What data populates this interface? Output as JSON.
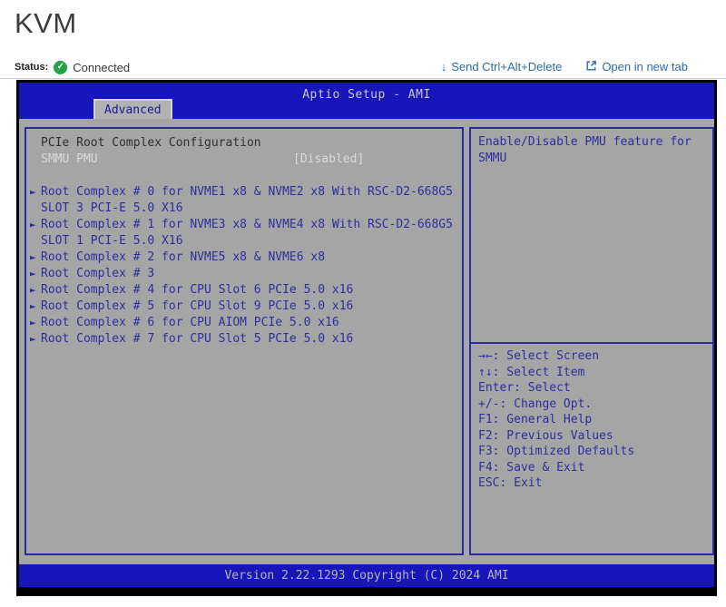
{
  "page": {
    "title": "KVM"
  },
  "status_bar": {
    "label": "Status:",
    "value": "Connected",
    "check_glyph": "✓",
    "links": [
      {
        "label": "Send Ctrl+Alt+Delete",
        "icon_glyph": "↓"
      },
      {
        "label": "Open in new tab"
      }
    ]
  },
  "bios": {
    "header": {
      "title": "Aptio Setup - AMI",
      "tab": "Advanced"
    },
    "icons": {
      "submenu_arrow": "►"
    },
    "left_panel": {
      "section_title": "PCIe Root Complex Configuration",
      "selected_option": {
        "label": "SMMU PMU",
        "value": "[Disabled]"
      },
      "rows": [
        {
          "marker": true,
          "text": "Root Complex # 0 for NVME1 x8 & NVME2 x8 With RSC-D2-668G5"
        },
        {
          "marker": false,
          "text": "SLOT 3 PCI-E 5.0 X16"
        },
        {
          "marker": true,
          "text": "Root Complex # 1 for NVME3 x8 & NVME4 x8 With RSC-D2-668G5"
        },
        {
          "marker": false,
          "text": "SLOT 1 PCI-E 5.0 X16"
        },
        {
          "marker": true,
          "text": "Root Complex # 2 for NVME5 x8 & NVME6 x8"
        },
        {
          "marker": true,
          "text": "Root Complex # 3"
        },
        {
          "marker": true,
          "text": "Root Complex # 4 for CPU Slot 6 PCIe 5.0 x16"
        },
        {
          "marker": true,
          "text": "Root Complex # 5 for CPU Slot 9 PCIe 5.0 x16"
        },
        {
          "marker": true,
          "text": "Root Complex # 6 for CPU AIOM PCIe 5.0 x16"
        },
        {
          "marker": true,
          "text": "Root Complex # 7 for CPU Slot 5 PCIe 5.0 x16"
        }
      ]
    },
    "right_panel": {
      "description": "Enable/Disable PMU feature for SMMU",
      "help_keys": [
        "→←: Select Screen",
        "↑↓: Select Item",
        "Enter: Select",
        "+/-: Change Opt.",
        "F1: General Help",
        "F2: Previous Values",
        "F3: Optimized Defaults",
        "F4: Save & Exit",
        "ESC: Exit"
      ]
    },
    "footer": "Version 2.22.1293 Copyright (C) 2024 AMI"
  },
  "colors": {
    "bios_header_blue": "#1616bb",
    "bios_body_gray": "#a5a5a5",
    "bios_navy_text": "#2e2e9e",
    "bios_border_navy": "#2b2ba0",
    "selected_item_light": "#d9d9d9",
    "link_blue": "#2c6ca4",
    "status_green": "#21a344"
  }
}
